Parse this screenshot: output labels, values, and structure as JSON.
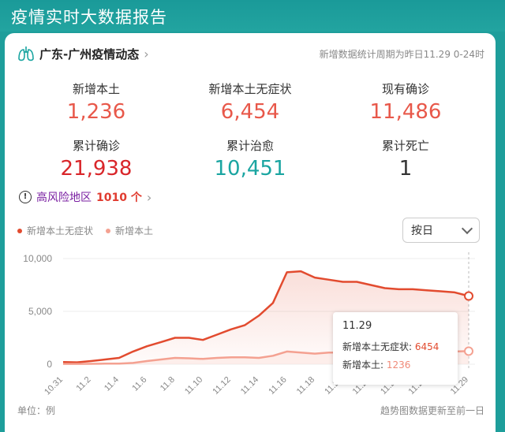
{
  "app": {
    "title": "疫情实时大数据报告"
  },
  "header": {
    "region": "广东-广州疫情动态",
    "period_note": "新增数据统计周期为昨日11.29 0-24时"
  },
  "stats": [
    {
      "label": "新增本土",
      "value": "1,236",
      "color": "#e8584a"
    },
    {
      "label": "新增本土无症状",
      "value": "6,454",
      "color": "#e8584a"
    },
    {
      "label": "现有确诊",
      "value": "11,486",
      "color": "#e8584a"
    },
    {
      "label": "累计确诊",
      "value": "21,938",
      "color": "#d9262a"
    },
    {
      "label": "累计治愈",
      "value": "10,451",
      "color": "#1aa5a1"
    },
    {
      "label": "累计死亡",
      "value": "1",
      "color": "#333333"
    }
  ],
  "risk": {
    "label": "高风险地区",
    "count": "1010 个"
  },
  "legend": {
    "series1": "新增本土无症状",
    "series2": "新增本土"
  },
  "select": {
    "value": "按日"
  },
  "tooltip": {
    "date": "11.29",
    "series1_label": "新增本土无症状:",
    "series1_value": "6454",
    "series2_label": "新增本土:",
    "series2_value": "1236"
  },
  "footer": {
    "unit": "单位：例",
    "note": "趋势图数据更新至前一日"
  },
  "chart_data": {
    "type": "area",
    "x": [
      "10.31",
      "11.1",
      "11.2",
      "11.3",
      "11.4",
      "11.5",
      "11.6",
      "11.7",
      "11.8",
      "11.9",
      "11.10",
      "11.11",
      "11.12",
      "11.13",
      "11.14",
      "11.15",
      "11.16",
      "11.17",
      "11.18",
      "11.19",
      "11.20",
      "11.21",
      "11.22",
      "11.23",
      "11.24",
      "11.25",
      "11.26",
      "11.27",
      "11.28",
      "11.29"
    ],
    "x_ticks": [
      "10.31",
      "11.2",
      "11.4",
      "11.6",
      "11.8",
      "11.10",
      "11.12",
      "11.14",
      "11.16",
      "11.18",
      "11.20",
      "11.22",
      "11.24",
      "11.26",
      "11.29"
    ],
    "y_ticks": [
      "0",
      "5,000",
      "10,000"
    ],
    "ylim": [
      0,
      10000
    ],
    "series": [
      {
        "name": "新增本土无症状",
        "color": "#e24b2f",
        "values": [
          200,
          180,
          300,
          450,
          600,
          1200,
          1700,
          2100,
          2500,
          2500,
          2300,
          2800,
          3300,
          3700,
          4600,
          5800,
          8700,
          8800,
          8200,
          8000,
          7800,
          7800,
          7500,
          7200,
          7100,
          7100,
          7000,
          6900,
          6800,
          6454
        ]
      },
      {
        "name": "新增本土",
        "color": "#f4a191",
        "values": [
          30,
          30,
          40,
          50,
          60,
          120,
          300,
          450,
          600,
          560,
          500,
          600,
          650,
          650,
          600,
          800,
          1200,
          1100,
          1000,
          1100,
          1100,
          1150,
          1150,
          1100,
          1200,
          1200,
          1150,
          1200,
          1200,
          1236
        ]
      }
    ]
  }
}
